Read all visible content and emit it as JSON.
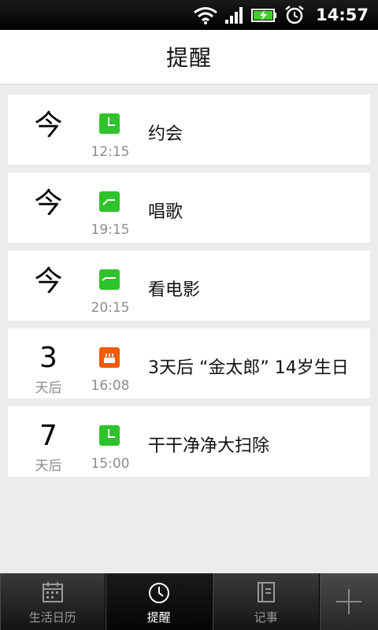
{
  "status_bar": {
    "time": "14:57"
  },
  "header": {
    "title": "提醒"
  },
  "reminders": [
    {
      "day": "今",
      "day_sub": "",
      "icon": "clock-icon",
      "icon_color": "#2fc32b",
      "time": "12:15",
      "title": "约会"
    },
    {
      "day": "今",
      "day_sub": "",
      "icon": "clock-icon",
      "icon_color": "#2fc32b",
      "time": "19:15",
      "title": "唱歌"
    },
    {
      "day": "今",
      "day_sub": "",
      "icon": "clock-icon",
      "icon_color": "#2fc32b",
      "time": "20:15",
      "title": "看电影"
    },
    {
      "day": "3",
      "day_sub": "天后",
      "icon": "birthday-cake-icon",
      "icon_color": "#f05a0a",
      "time": "16:08",
      "title": "3天后 “金太郎” 14岁生日"
    },
    {
      "day": "7",
      "day_sub": "天后",
      "icon": "clock-icon",
      "icon_color": "#2fc32b",
      "time": "15:00",
      "title": "干干净净大扫除"
    }
  ],
  "bottom_nav": {
    "tabs": [
      {
        "label": "生活日历",
        "icon": "calendar-icon"
      },
      {
        "label": "提醒",
        "icon": "clock-icon"
      },
      {
        "label": "记事",
        "icon": "notebook-icon"
      }
    ],
    "add_icon": "plus-icon"
  }
}
